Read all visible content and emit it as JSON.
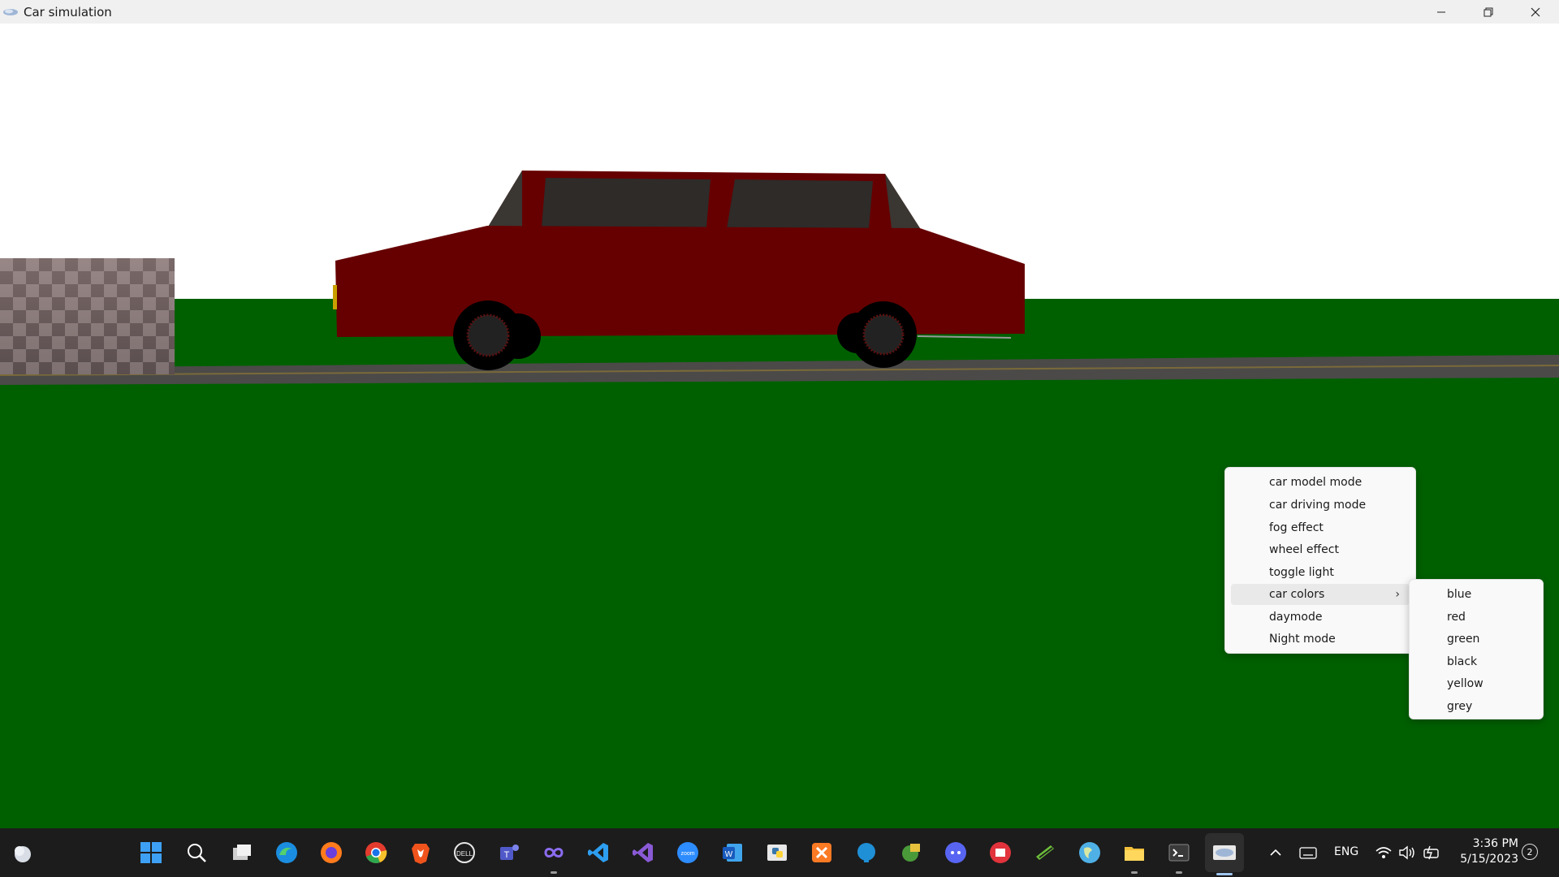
{
  "window": {
    "title": "Car simulation"
  },
  "colors": {
    "sky": "#ffffff",
    "grass": "#006000",
    "road": "#4a4a4a",
    "car_body": "#660000",
    "car_windows": "#2e2b29",
    "taskbar": "#1c1c1c"
  },
  "context_menu": {
    "items": [
      {
        "label": "car model mode"
      },
      {
        "label": "car driving mode"
      },
      {
        "label": "fog effect"
      },
      {
        "label": "wheel effect"
      },
      {
        "label": "toggle light"
      },
      {
        "label": "car colors",
        "has_submenu": true,
        "highlighted": true
      },
      {
        "label": "daymode"
      },
      {
        "label": "Night mode"
      }
    ],
    "submenu": {
      "items": [
        {
          "label": "blue"
        },
        {
          "label": "red"
        },
        {
          "label": "green"
        },
        {
          "label": "black"
        },
        {
          "label": "yellow"
        },
        {
          "label": "grey"
        }
      ]
    }
  },
  "taskbar": {
    "apps": [
      "weather-icon",
      "start-icon",
      "search-icon",
      "task-view-icon",
      "edge-icon",
      "firefox-icon",
      "chrome-icon",
      "brave-icon",
      "dell-icon",
      "teams-icon",
      "infinity-icon",
      "vscode-icon",
      "visual-studio-icon",
      "zoom-icon",
      "word-icon",
      "python-icon",
      "xampp-icon",
      "postgres-icon",
      "app-icon",
      "discord-icon",
      "myk-icon",
      "dev-icon",
      "globe-icon",
      "file-explorer-icon",
      "terminal-icon",
      "freeglut-icon"
    ],
    "tray": {
      "language": "ENG",
      "time": "3:36 PM",
      "date": "5/15/2023",
      "notifications": "2"
    }
  }
}
